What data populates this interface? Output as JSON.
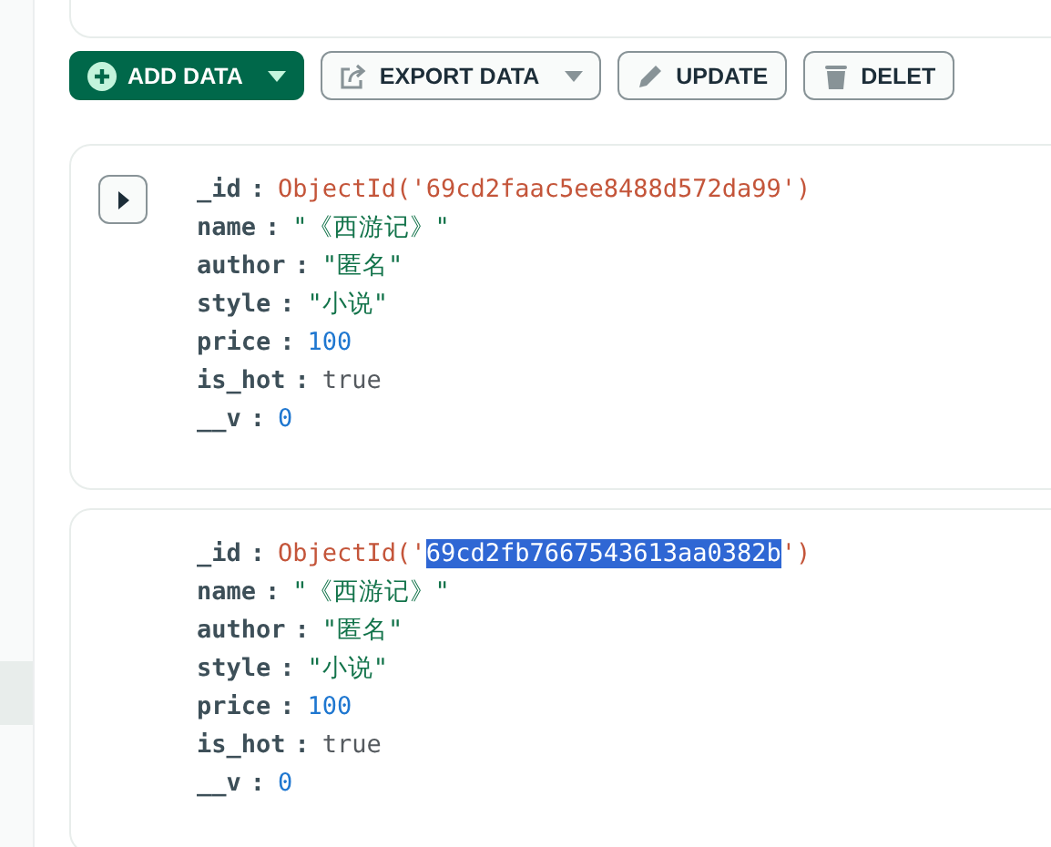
{
  "toolbar": {
    "buttons": [
      {
        "label": "ADD DATA",
        "kind": "primary",
        "dropdown": true
      },
      {
        "label": "EXPORT DATA",
        "kind": "default",
        "dropdown": true
      },
      {
        "label": "UPDATE",
        "kind": "default",
        "dropdown": false
      },
      {
        "label": "DELET",
        "kind": "default",
        "dropdown": false
      }
    ]
  },
  "documents": [
    {
      "show_expand": true,
      "fields": [
        {
          "key": "_id",
          "sep": ":",
          "kind": "objectid",
          "prefix": "ObjectId('",
          "value": "69cd2faac5ee8488d572da99",
          "suffix": "')",
          "selected": false
        },
        {
          "key": "name",
          "sep": ":",
          "kind": "string",
          "value": "\"《西游记》\""
        },
        {
          "key": "author",
          "sep": ":",
          "kind": "string",
          "value": "\"匿名\""
        },
        {
          "key": "style",
          "sep": ":",
          "kind": "string",
          "value": "\"小说\""
        },
        {
          "key": "price",
          "sep": ":",
          "kind": "number",
          "value": "100"
        },
        {
          "key": "is_hot",
          "sep": ":",
          "kind": "boolean",
          "value": "true"
        },
        {
          "key": "__v",
          "sep": ":",
          "kind": "number",
          "value": "0"
        }
      ]
    },
    {
      "show_expand": false,
      "fields": [
        {
          "key": "_id",
          "sep": ":",
          "kind": "objectid",
          "prefix": "ObjectId('",
          "value": "69cd2fb7667543613aa0382b",
          "suffix": "')",
          "selected": true
        },
        {
          "key": "name",
          "sep": ":",
          "kind": "string",
          "value": "\"《西游记》\""
        },
        {
          "key": "author",
          "sep": ":",
          "kind": "string",
          "value": "\"匿名\""
        },
        {
          "key": "style",
          "sep": ":",
          "kind": "string",
          "value": "\"小说\""
        },
        {
          "key": "price",
          "sep": ":",
          "kind": "number",
          "value": "100"
        },
        {
          "key": "is_hot",
          "sep": ":",
          "kind": "boolean",
          "value": "true"
        },
        {
          "key": "__v",
          "sep": ":",
          "kind": "number",
          "value": "0"
        }
      ]
    }
  ]
}
